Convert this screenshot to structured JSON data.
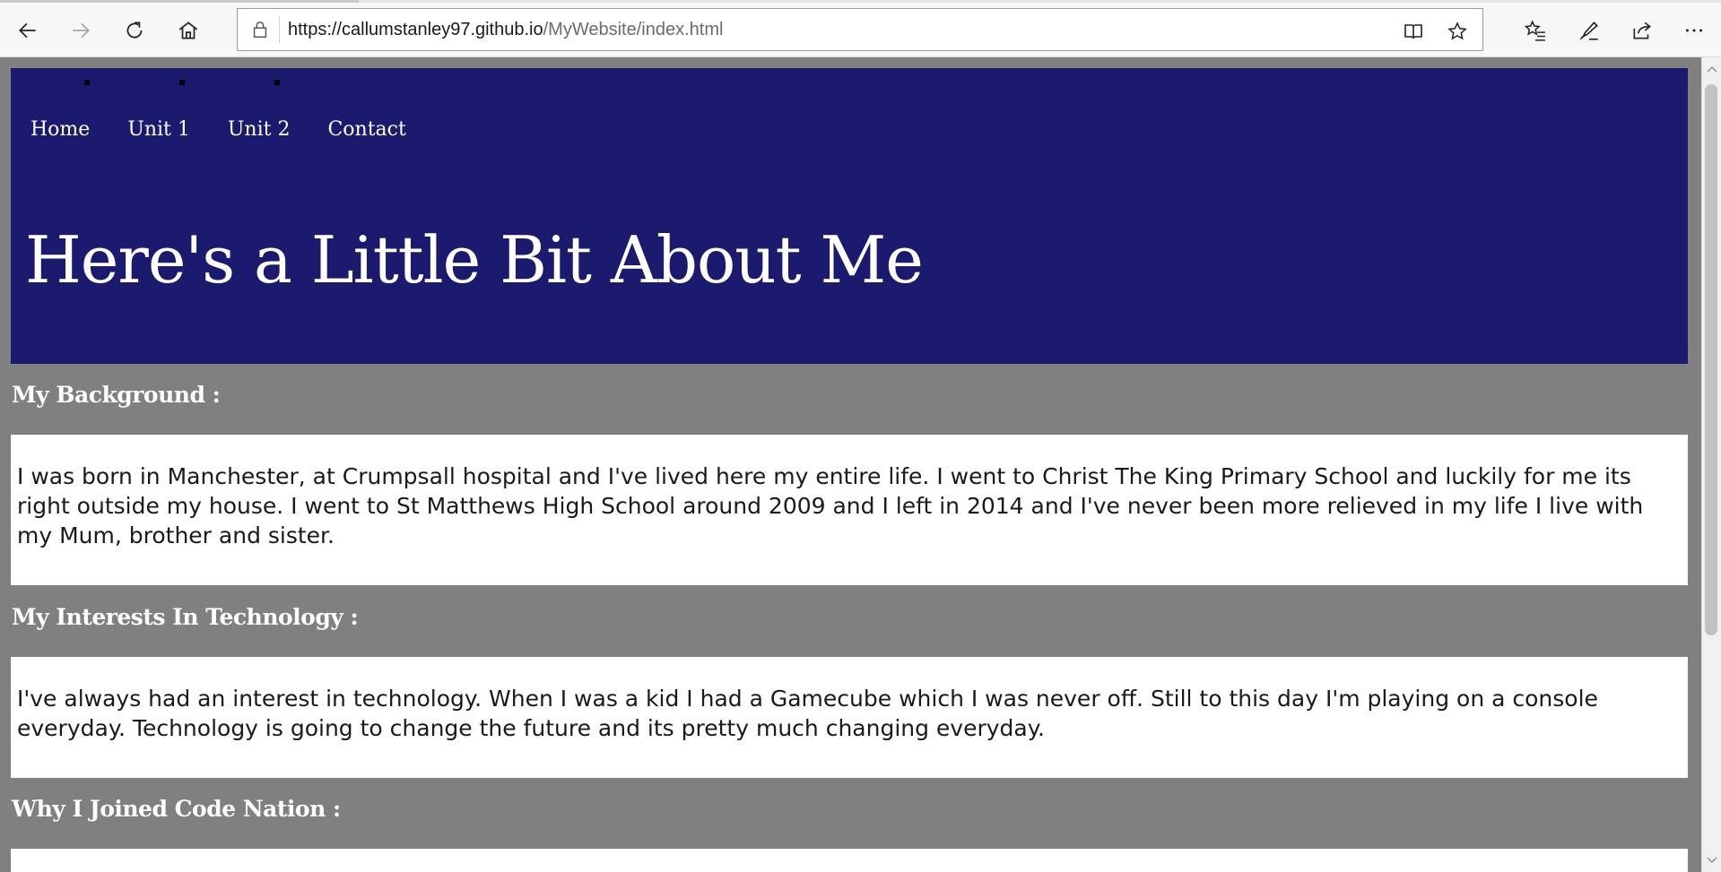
{
  "browser": {
    "url_host": "https://callumstanley97.github.io",
    "url_path": "/MyWebsite/index.html",
    "icons": {
      "back": "back-arrow-icon",
      "forward": "forward-arrow-icon",
      "refresh": "refresh-icon",
      "home": "home-icon",
      "lock": "lock-icon",
      "reading_view": "reading-view-icon",
      "favorite": "star-icon",
      "favorites_list": "favorites-list-icon",
      "notes": "pen-icon",
      "share": "share-icon",
      "more": "more-icon"
    }
  },
  "site": {
    "header_color": "#1b1a6e",
    "page_background": "#808080",
    "nav": [
      {
        "label": "Home"
      },
      {
        "label": "Unit 1"
      },
      {
        "label": "Unit 2"
      },
      {
        "label": "Contact"
      }
    ],
    "title": "Here's a Little Bit About Me",
    "sections": [
      {
        "heading": "My Background :",
        "text": "I was born in Manchester, at Crumpsall hospital and I've lived here my entire life. I went to Christ The King Primary School and luckily for me its right outside my house. I went to St Matthews High School around 2009 and I left in 2014 and I've never been more relieved in my life I live with my Mum, brother and sister."
      },
      {
        "heading": "My Interests In Technology :",
        "text": "I've always had an interest in technology. When I was a kid I had a Gamecube which I was never off. Still to this day I'm playing on a console everyday. Technology is going to change the future and its pretty much changing everyday."
      },
      {
        "heading": "Why I Joined Code Nation :",
        "text": ""
      }
    ]
  }
}
